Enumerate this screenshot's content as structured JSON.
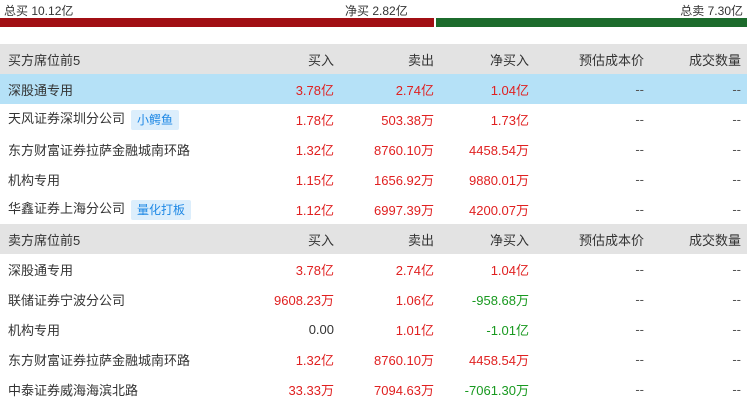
{
  "summary": {
    "total_buy": "总买 10.12亿",
    "net_buy": "净买 2.82亿",
    "total_sell": "总卖 7.30亿"
  },
  "colors": {
    "buy_bar": "#a10f14",
    "sell_bar": "#1c6b2c",
    "up": "#e02020",
    "down": "#18991f",
    "tag_bg": "#dceefc",
    "tag_text": "#1e88e5",
    "highlight": "#b5e1f7"
  },
  "buy_section": {
    "headers": [
      "买方席位前5",
      "买入",
      "卖出",
      "净买入",
      "预估成本价",
      "成交数量"
    ],
    "rows": [
      {
        "name": "深股通专用",
        "tag": "",
        "buy": "3.78亿",
        "sell": "2.74亿",
        "net": "1.04亿",
        "cost": "--",
        "volume": "--"
      },
      {
        "name": "天风证券深圳分公司",
        "tag": "小鳄鱼",
        "buy": "1.78亿",
        "sell": "503.38万",
        "net": "1.73亿",
        "cost": "--",
        "volume": "--"
      },
      {
        "name": "东方财富证券拉萨金融城南环路",
        "tag": "",
        "buy": "1.32亿",
        "sell": "8760.10万",
        "net": "4458.54万",
        "cost": "--",
        "volume": "--"
      },
      {
        "name": "机构专用",
        "tag": "",
        "buy": "1.15亿",
        "sell": "1656.92万",
        "net": "9880.01万",
        "cost": "--",
        "volume": "--"
      },
      {
        "name": "华鑫证券上海分公司",
        "tag": "量化打板",
        "buy": "1.12亿",
        "sell": "6997.39万",
        "net": "4200.07万",
        "cost": "--",
        "volume": "--"
      }
    ]
  },
  "sell_section": {
    "headers": [
      "卖方席位前5",
      "买入",
      "卖出",
      "净买入",
      "预估成本价",
      "成交数量"
    ],
    "rows": [
      {
        "name": "深股通专用",
        "buy": "3.78亿",
        "sell": "2.74亿",
        "net": "1.04亿",
        "cost": "--",
        "volume": "--"
      },
      {
        "name": "联储证券宁波分公司",
        "buy": "9608.23万",
        "sell": "1.06亿",
        "net": "-958.68万",
        "cost": "--",
        "volume": "--"
      },
      {
        "name": "机构专用",
        "buy": "0.00",
        "sell": "1.01亿",
        "net": "-1.01亿",
        "cost": "--",
        "volume": "--"
      },
      {
        "name": "东方财富证券拉萨金融城南环路",
        "buy": "1.32亿",
        "sell": "8760.10万",
        "net": "4458.54万",
        "cost": "--",
        "volume": "--"
      },
      {
        "name": "中泰证券威海海滨北路",
        "buy": "33.33万",
        "sell": "7094.63万",
        "net": "-7061.30万",
        "cost": "--",
        "volume": "--"
      }
    ]
  }
}
